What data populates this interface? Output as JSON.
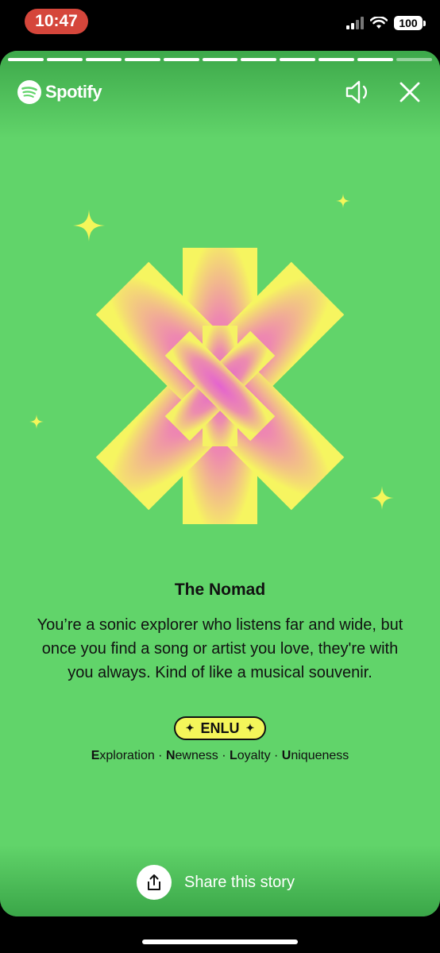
{
  "status_bar": {
    "time": "10:47",
    "battery": "100"
  },
  "story": {
    "progress_segments_total": 11,
    "progress_segments_done": 10,
    "brand": "Spotify",
    "title": "The Nomad",
    "description": "You’re a sonic explorer who listens far and wide, but once you find a song or artist you love, they're with you always. Kind of like a musical souvenir.",
    "code": "ENLU",
    "traits": [
      {
        "initial": "E",
        "rest": "xploration"
      },
      {
        "initial": "N",
        "rest": "ewness"
      },
      {
        "initial": "L",
        "rest": "oyalty"
      },
      {
        "initial": "U",
        "rest": "niqueness"
      }
    ],
    "share_label": "Share this story"
  },
  "colors": {
    "background": "#61d46a",
    "accent_yellow": "#f4f65a",
    "accent_pink": "#e86ac6",
    "status_time_pill": "#d5463b"
  },
  "icons": [
    "spotify-logo-icon",
    "speaker-icon",
    "close-icon",
    "share-icon",
    "sparkle-icon",
    "signal-icon",
    "wifi-icon"
  ]
}
